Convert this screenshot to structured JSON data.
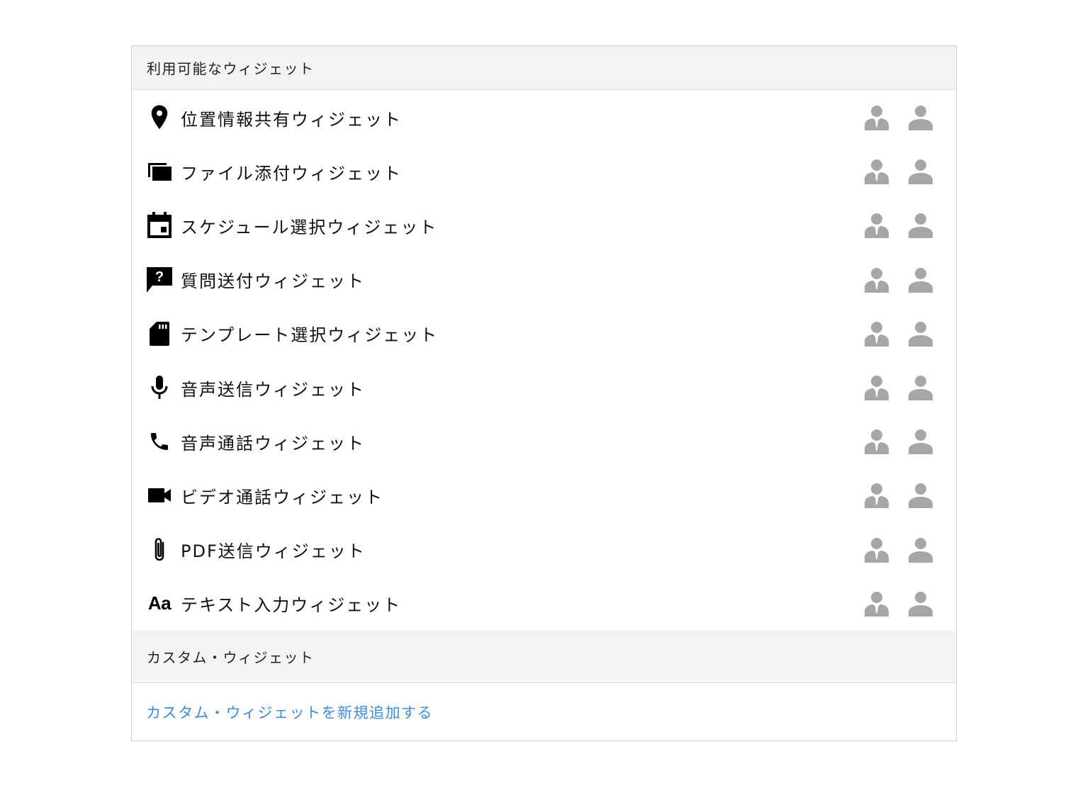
{
  "available_section": {
    "title": "利用可能なウィジェット"
  },
  "widgets": [
    {
      "label": "位置情報共有ウィジェット",
      "icon": "location-pin-icon"
    },
    {
      "label": "ファイル添付ウィジェット",
      "icon": "file-stack-icon"
    },
    {
      "label": "スケジュール選択ウィジェット",
      "icon": "calendar-icon"
    },
    {
      "label": "質問送付ウィジェット",
      "icon": "question-bubble-icon"
    },
    {
      "label": "テンプレート選択ウィジェット",
      "icon": "sd-card-icon"
    },
    {
      "label": "音声送信ウィジェット",
      "icon": "microphone-icon"
    },
    {
      "label": "音声通話ウィジェット",
      "icon": "phone-icon"
    },
    {
      "label": "ビデオ通話ウィジェット",
      "icon": "video-camera-icon"
    },
    {
      "label": "PDF送信ウィジェット",
      "icon": "paperclip-icon"
    },
    {
      "label": "テキスト入力ウィジェット",
      "icon": "text-aa-icon",
      "icon_text": "Aa"
    }
  ],
  "role_icons": [
    "operator-icon",
    "user-icon"
  ],
  "custom_section": {
    "title": "カスタム・ウィジェット",
    "add_link": "カスタム・ウィジェットを新規追加する"
  },
  "colors": {
    "link": "#3b8de0",
    "role_icon": "#a6a6a6",
    "header_bg": "#f3f3f3",
    "border": "#cfcfcf"
  }
}
